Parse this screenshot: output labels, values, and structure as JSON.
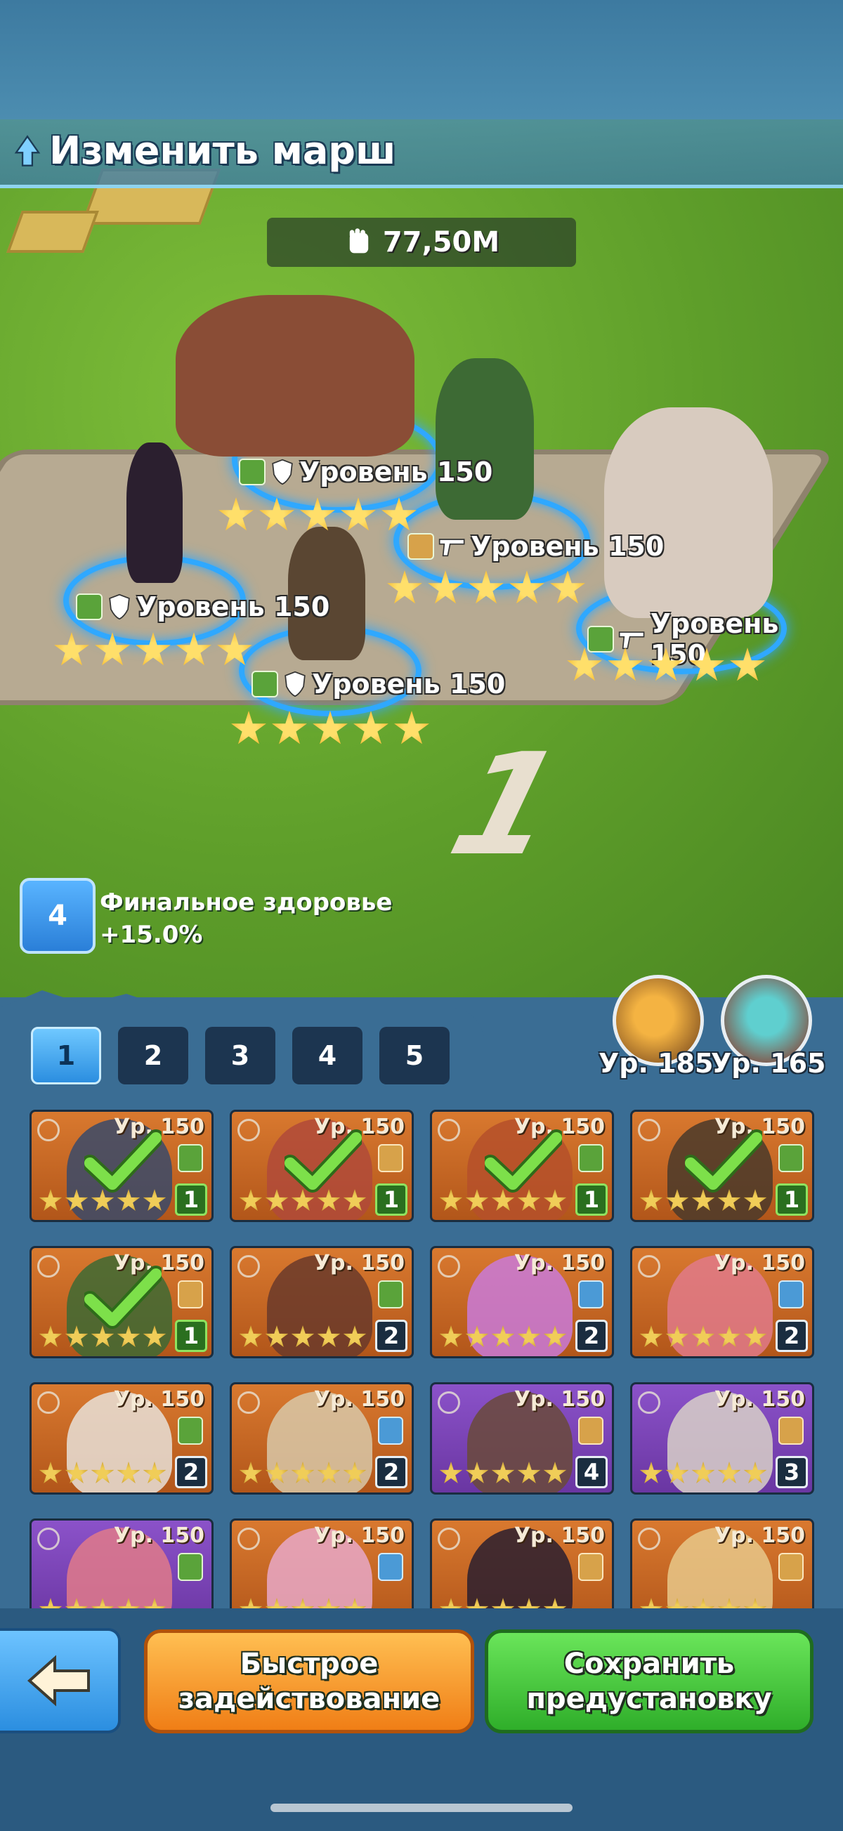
{
  "header": {
    "title": "Изменить марш"
  },
  "power": {
    "value": "77,50M"
  },
  "formation": {
    "number": "1",
    "heroes": [
      {
        "level_label": "Уровень 150",
        "stars": 5
      },
      {
        "level_label": "Уровень 150",
        "stars": 5
      },
      {
        "level_label": "Уровень 150",
        "stars": 5
      },
      {
        "level_label": "Уровень 150",
        "stars": 5
      },
      {
        "level_label": "Уровень 150",
        "stars": 5
      }
    ]
  },
  "buff": {
    "level": "4",
    "name": "Финальное здоровье",
    "value": "+15.0%"
  },
  "tabs": [
    "1",
    "2",
    "3",
    "4",
    "5"
  ],
  "active_tab": "1",
  "pets": [
    {
      "level": "Ур. 185"
    },
    {
      "level": "Ур. 165"
    }
  ],
  "roster": [
    {
      "level": "Ур. 150",
      "count": "1",
      "selected": true
    },
    {
      "level": "Ур. 150",
      "count": "1",
      "selected": true
    },
    {
      "level": "Ур. 150",
      "count": "1",
      "selected": true
    },
    {
      "level": "Ур. 150",
      "count": "1",
      "selected": true
    },
    {
      "level": "Ур. 150",
      "count": "1",
      "selected": true
    },
    {
      "level": "Ур. 150",
      "count": "2",
      "selected": false
    },
    {
      "level": "Ур. 150",
      "count": "2",
      "selected": false
    },
    {
      "level": "Ур. 150",
      "count": "2",
      "selected": false
    },
    {
      "level": "Ур. 150",
      "count": "2",
      "selected": false
    },
    {
      "level": "Ур. 150",
      "count": "2",
      "selected": false
    },
    {
      "level": "Ур. 150",
      "count": "4",
      "selected": false
    },
    {
      "level": "Ур. 150",
      "count": "3",
      "selected": false
    },
    {
      "level": "Ур. 150",
      "count": "",
      "selected": false
    },
    {
      "level": "Ур. 150",
      "count": "",
      "selected": false
    },
    {
      "level": "Ур. 150",
      "count": "",
      "selected": false
    },
    {
      "level": "Ур. 150",
      "count": "",
      "selected": false
    }
  ],
  "buttons": {
    "quick_deploy": "Быстрое задействование",
    "save_preset": "Сохранить предустановку"
  }
}
